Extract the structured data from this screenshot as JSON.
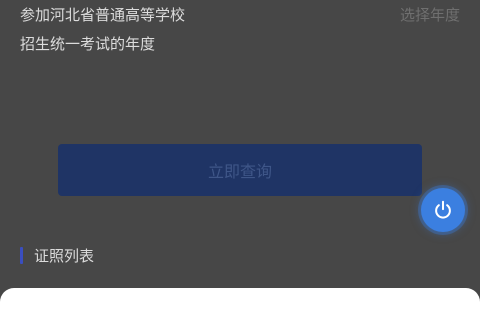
{
  "form": {
    "year_field": {
      "label_line1": "参加河北省普通高等学校",
      "label_line2": "招生统一考试的年度",
      "placeholder": "选择年度"
    },
    "submit_label": "立即查询"
  },
  "section": {
    "title": "证照列表"
  },
  "icons": {
    "fab": "power-icon"
  },
  "colors": {
    "accent": "#3b7fe0",
    "button_bg": "#1f3465",
    "section_bar": "#3a4ec0"
  }
}
